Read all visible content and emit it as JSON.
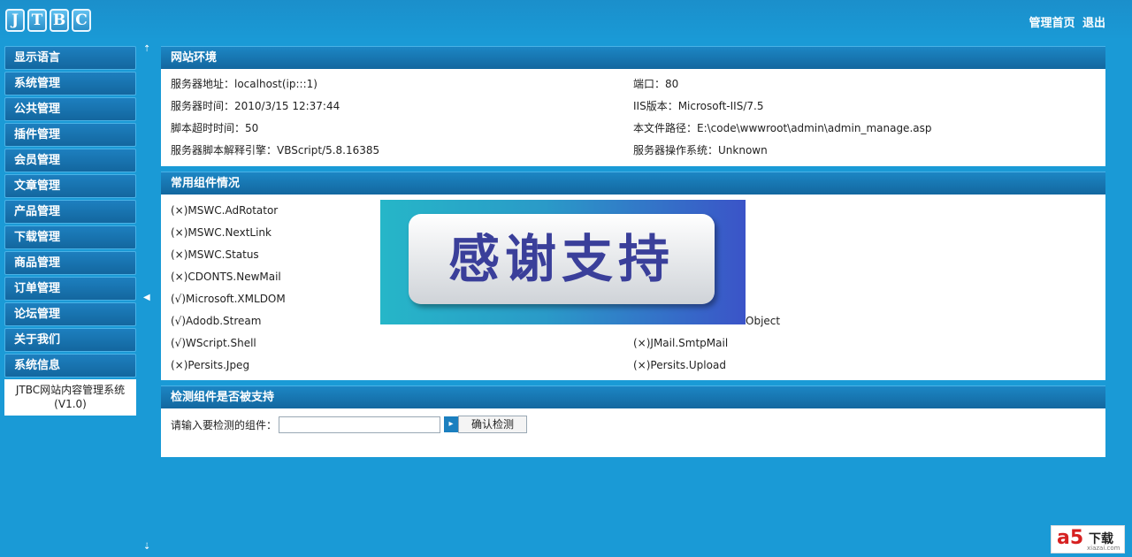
{
  "header": {
    "logo_letters": [
      "J",
      "T",
      "B",
      "C"
    ],
    "links": [
      "管理首页",
      "退出"
    ]
  },
  "sidebar": {
    "items": [
      {
        "label": "显示语言"
      },
      {
        "label": "系统管理"
      },
      {
        "label": "公共管理"
      },
      {
        "label": "插件管理"
      },
      {
        "label": "会员管理"
      },
      {
        "label": "文章管理"
      },
      {
        "label": "产品管理"
      },
      {
        "label": "下载管理"
      },
      {
        "label": "商品管理"
      },
      {
        "label": "订单管理"
      },
      {
        "label": "论坛管理"
      },
      {
        "label": "关于我们"
      },
      {
        "label": "系统信息"
      }
    ],
    "footer_line1": "JTBC网站内容管理系统",
    "footer_line2": "(V1.0)"
  },
  "toggles": {
    "up": "⇡",
    "collapse": "◀",
    "down": "⇣"
  },
  "env_panel": {
    "title": "网站环境",
    "rows": [
      [
        "服务器地址：localhost(ip:::1)",
        "端口：80"
      ],
      [
        "服务器时间：2010/3/15 12:37:44",
        "IIS版本：Microsoft-IIS/7.5"
      ],
      [
        "脚本超时时间：50",
        "本文件路径：E:\\code\\wwwroot\\admin\\admin_manage.asp"
      ],
      [
        "服务器脚本解释引擎：VBScript/5.8.16385",
        "服务器操作系统：Unknown"
      ]
    ]
  },
  "components_panel": {
    "title": "常用组件情况",
    "rows": [
      [
        "(×)MSWC.AdRotator",
        ""
      ],
      [
        "(×)MSWC.NextLink",
        ""
      ],
      [
        "(×)MSWC.Status",
        ""
      ],
      [
        "(×)CDONTS.NewMail",
        ""
      ],
      [
        "(√)Microsoft.XMLDOM",
        ""
      ],
      [
        "(√)Adodb.Stream",
        "Object"
      ],
      [
        "(√)WScript.Shell",
        "(×)JMail.SmtpMail"
      ],
      [
        "(×)Persits.Jpeg",
        "(×)Persits.Upload"
      ]
    ]
  },
  "check_panel": {
    "title": "检测组件是否被支持",
    "label": "请输入要检测的组件：",
    "input_value": "",
    "arrow": "▸",
    "button_label": "确认检测"
  },
  "overlay": {
    "text": "感谢支持"
  },
  "watermark": {
    "logo": "a5",
    "label": "下载",
    "url": "xiazai.com"
  }
}
